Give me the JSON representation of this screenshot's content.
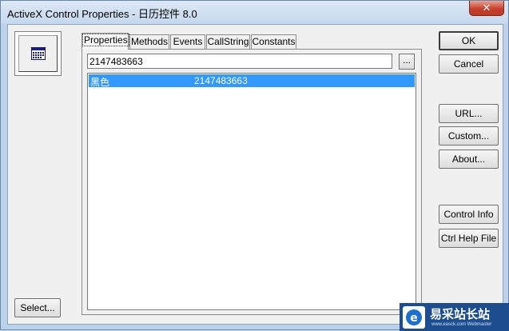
{
  "window": {
    "title": "ActiveX Control Properties - 日历控件 8.0",
    "close_label": "✕"
  },
  "tabs": [
    "Properties",
    "Methods",
    "Events",
    "CallString",
    "Constants"
  ],
  "value_input": {
    "value": "2147483663",
    "browse_label": "..."
  },
  "property_list": {
    "rows": [
      {
        "name": "黑色",
        "value": "2147483663"
      }
    ]
  },
  "buttons": {
    "select": "Select...",
    "ok": "OK",
    "cancel": "Cancel",
    "url": "URL...",
    "custom": "Custom...",
    "about": "About...",
    "control_info": "Control Info",
    "ctrl_help_file": "Ctrl Help File"
  },
  "watermark": {
    "text": "易采站长站",
    "subtext": "www.easck.com Webmaster"
  },
  "colors": {
    "selection": "#3399ff",
    "title_bar": "#c7d9ee",
    "close_button": "#c7402c",
    "watermark_bg": "#1d4d8f"
  },
  "icons": {
    "control_icon": "calendar-icon",
    "watermark_logo": "e-logo-icon"
  }
}
